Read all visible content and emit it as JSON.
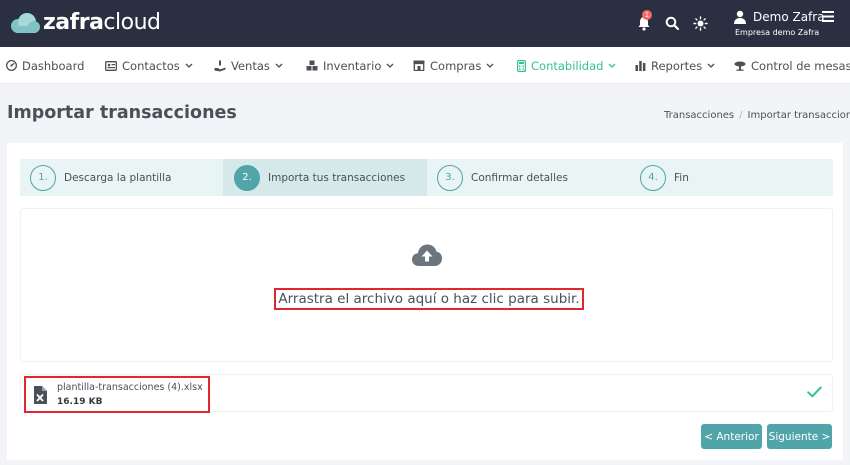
{
  "brand": {
    "part1": "zafra",
    "part2": "cloud"
  },
  "header": {
    "notifications_badge": "1",
    "user_name": "Demo Zafra",
    "company": "Empresa demo Zafra"
  },
  "nav": [
    {
      "label": "Dashboard",
      "icon": "dashboard-icon"
    },
    {
      "label": "Contactos",
      "icon": "contacts-icon"
    },
    {
      "label": "Ventas",
      "icon": "sales-icon"
    },
    {
      "label": "Inventario",
      "icon": "inventory-icon"
    },
    {
      "label": "Compras",
      "icon": "store-icon"
    },
    {
      "label": "Contabilidad",
      "icon": "calculator-icon",
      "active": true
    },
    {
      "label": "Reportes",
      "icon": "bar-chart-icon"
    },
    {
      "label": "Control de mesas",
      "icon": "table-control-icon"
    }
  ],
  "page": {
    "title": "Importar transacciones",
    "breadcrumb": [
      "Transacciones",
      "Importar transacciones"
    ]
  },
  "steps": [
    {
      "num": "1.",
      "label": "Descarga la plantilla"
    },
    {
      "num": "2.",
      "label": "Importa tus transacciones",
      "active": true
    },
    {
      "num": "3.",
      "label": "Confirmar detalles"
    },
    {
      "num": "4.",
      "label": "Fin"
    }
  ],
  "dropzone": {
    "message": "Arrastra el archivo aquí o haz clic para subir."
  },
  "file": {
    "name": "plantilla-transacciones (4).xlsx",
    "size": "16.19 KB"
  },
  "buttons": {
    "prev": "< Anterior",
    "next": "Siguiente >"
  },
  "colors": {
    "topbar": "#2a3042",
    "accent": "#50a5a8",
    "active_nav": "#34c38f",
    "highlight": "#e0262e"
  }
}
